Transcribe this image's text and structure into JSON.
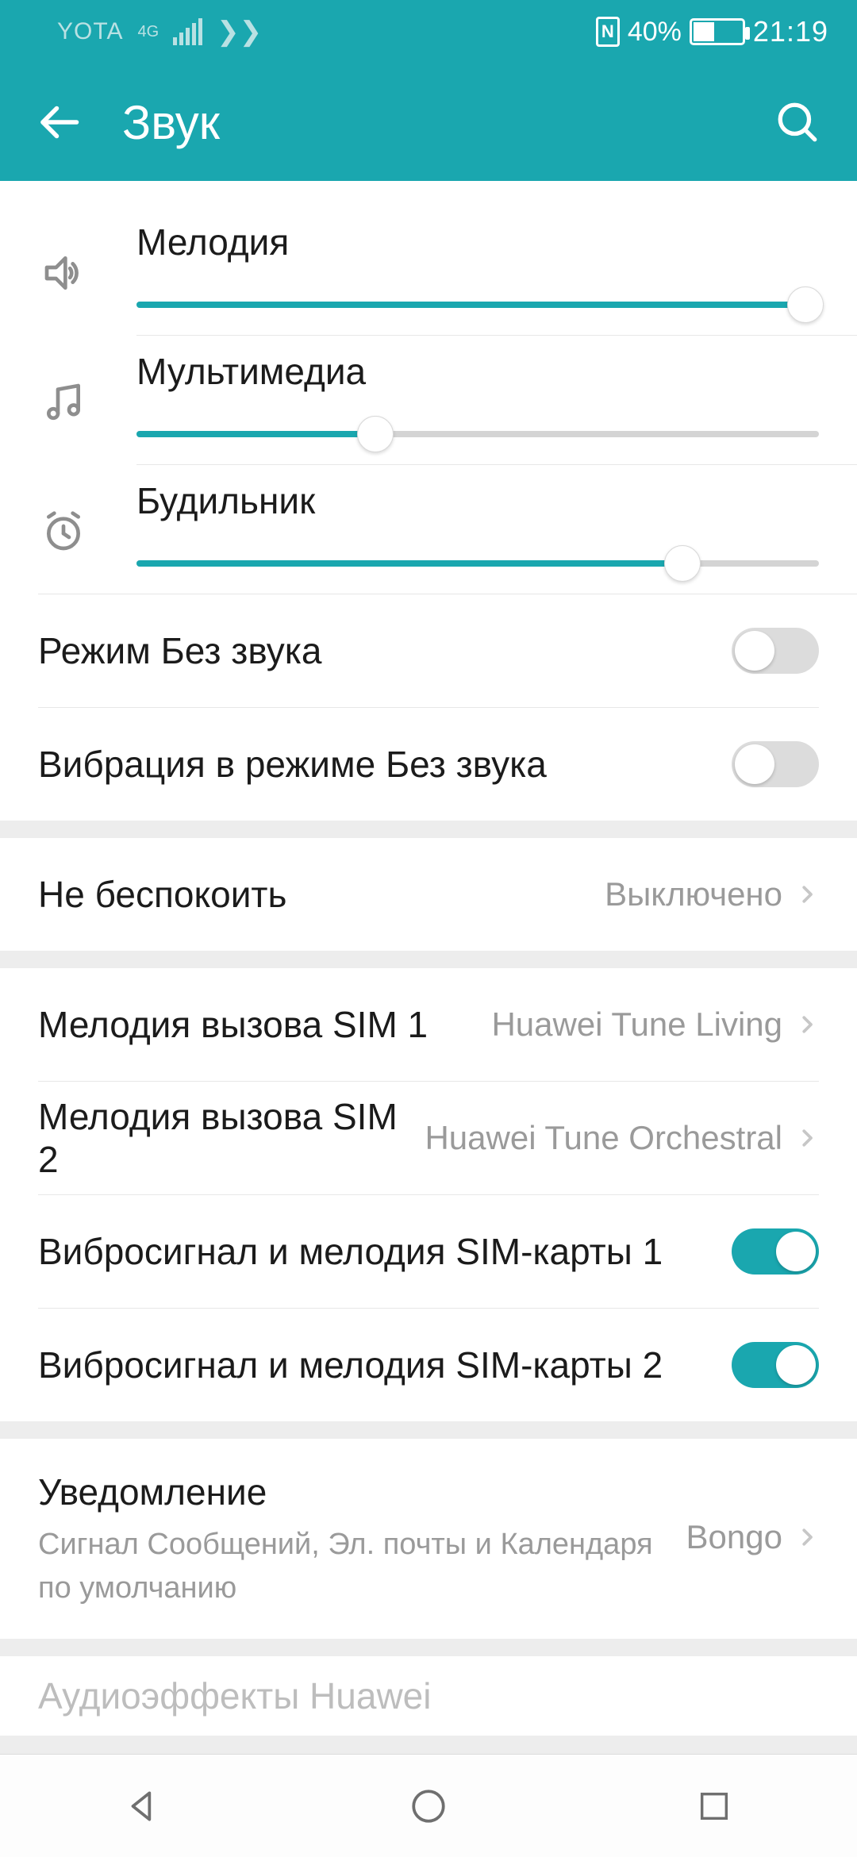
{
  "status": {
    "carrier": "YOTA",
    "net": "4G",
    "battery_pct": "40%",
    "time": "21:19"
  },
  "appbar": {
    "title": "Звук"
  },
  "sliders": {
    "ringtone": {
      "label": "Мелодия",
      "value": 98
    },
    "media": {
      "label": "Мультимедиа",
      "value": 35
    },
    "alarm": {
      "label": "Будильник",
      "value": 80
    }
  },
  "toggles": {
    "silent": {
      "label": "Режим Без звука",
      "on": false
    },
    "vib_silent": {
      "label": "Вибрация в режиме Без звука",
      "on": false
    },
    "vib_sim1": {
      "label": "Вибросигнал и мелодия SIM-карты 1",
      "on": true
    },
    "vib_sim2": {
      "label": "Вибросигнал и мелодия SIM-карты 2",
      "on": true
    }
  },
  "links": {
    "dnd": {
      "label": "Не беспокоить",
      "value": "Выключено"
    },
    "sim1": {
      "label": "Мелодия вызова SIM 1",
      "value": "Huawei Tune Living"
    },
    "sim2": {
      "label": "Мелодия вызова SIM 2",
      "value": "Huawei Tune Orchestral"
    },
    "notif": {
      "title": "Уведомление",
      "subtitle": "Сигнал Сообщений, Эл. почты и Календаря по умолчанию",
      "value": "Bongo"
    },
    "effects": {
      "label": "Аудиоэффекты Huawei"
    }
  }
}
